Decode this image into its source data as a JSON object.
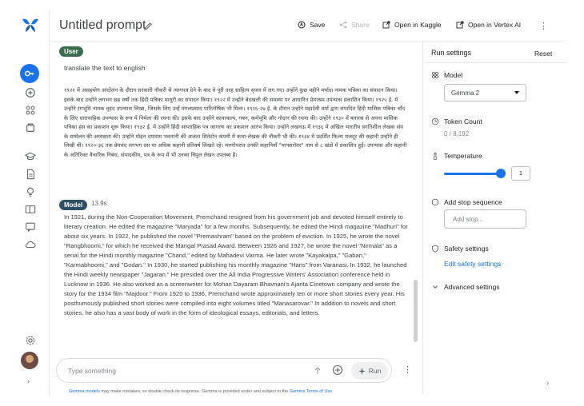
{
  "header": {
    "title": "Untitled prompt",
    "save_label": "Save",
    "share_label": "Share",
    "kaggle_label": "Open in Kaggle",
    "vertex_label": "Open in Vertex AI"
  },
  "chat": {
    "user_role": "User",
    "user_text": "translate the text to english",
    "hindi_text": "१९२१ में असहयोग आंदोलन के दौरान सरकारी नौकरी से त्यागपत्र देने के बाद वे पूरी तरह साहित्य सृजन में लग गए। उन्होंने कुछ महीने मर्यादा नामक पत्रिका का संपादन किया। इसके बाद उन्होंने लगभग छह वर्षों तक हिंदी पत्रिका माधुरी का संपादन किया। १९२२ में उन्होंने बेदखली की समस्या पर आधारित प्रेमाश्रम उपन्यास प्रकाशित किया। १९२५ ई. में उन्होंने रंगभूमि नामक वृहद उपन्यास लिखा, जिसके लिए उन्हें मंगलप्रसाद पारितोषिक भी मिला। १९२६-२७ ई. के दौरान उन्होंने महादेवी वर्मा द्वारा संपादित हिंदी मासिक पत्रिका चाँद के लिए धारावाहिक उपन्यास के रूप में निर्मला की रचना की। इसके बाद उन्होंने कायाकल्प, गबन, कर्मभूमि और गोदान की रचना की। उन्होंने १९३० में बनारस से अपना मासिक पत्रिका हंस का प्रकाशन शुरू किया। १९३२ ई. में उन्होंने हिंदी साप्ताहिक पत्र जागरण का प्रकाशन आरंभ किया। उन्होंने लखनऊ में १९३६ में अखिल भारतीय प्रगतिशील लेखक संघ के सम्मेलन की अध्यक्षता की। उन्होंने मोहन दयाराम भवनानी की अजंता सिनेटोन कंपनी में कथा-लेखक की नौकरी भी की। १९३४ में प्रदर्शित फिल्म मजदूर की कहानी उन्होंने ही लिखी थी। १९२०-३६ तक प्रेमचंद लगभग दस या अधिक कहानी प्रतिवर्ष लिखते रहे। मरणोपरांत उनकी कहानियाँ \"मानसरोवर\" नाम से ८ खंडों में प्रकाशित हुईं। उपन्यास और कहानी के अतिरिक्त वैचारिक निबंध, संपादकीय, पत्र के रूप में भी उनका विपुल लेखन उपलब्ध है।",
    "model_role": "Model",
    "model_time": "13.9s",
    "model_text": "In 1921, during the Non-Cooperation Movement, Premchand resigned from his government job and devoted himself entirely to literary creation. He edited the magazine \"Maryada\" for a few months. Subsequently, he edited the Hindi magazine \"Madhuri\" for about six years. In 1922, he published the novel \"Premashram\" based on the problem of eviction. In 1925, he wrote the novel \"Rangbhoomi,\" for which he received the Mangal Prasad Award. Between 1926 and 1927, he wrote the novel \"Nirmala\" as a serial for the Hindi monthly magazine \"Chand,\" edited by Mahadevi Varma. He later wrote \"Kayakalpa,\" \"Gaban,\" \"Karmabhoomi,\" and \"Godan.\" In 1930, he started publishing his monthly magazine \"Hans\" from Varanasi. In 1932, he launched the Hindi weekly newspaper \"Jagaran.\" He presided over the All India Progressive Writers' Association conference held in Lucknow in 1936. He also worked as a screenwriter for Mohan Dayaram Bhavnani's Ajanta Cinetown company and wrote the story for the 1934 film \"Majdoor.\" From 1920 to 1936, Premchand wrote approximately ten or more short stories every year. His posthumously published short stories were compiled into eight volumes titled \"Manasarovar.\" In addition to novels and short stories, he also has a vast body of work in the form of ideological essays, editorials, and letters."
  },
  "composer": {
    "placeholder": "Type something",
    "run_label": "Run",
    "disclaimer_link1": "Gemma models",
    "disclaimer_mid": " may make mistakes, so double check its response. Gemma is provided under and subject to the ",
    "disclaimer_link2": "Gemma Terms of Use"
  },
  "settings": {
    "title": "Run settings",
    "reset_label": "Reset",
    "model_label": "Model",
    "model_value": "Gemma 2",
    "token_label": "Token Count",
    "token_value": "0 / 8,192",
    "temperature_label": "Temperature",
    "temperature_value": "1",
    "temperature_fraction": 1.0,
    "stop_label": "Add stop sequence",
    "stop_placeholder": "Add stop...",
    "safety_label": "Safety settings",
    "safety_link": "Edit safety settings",
    "advanced_label": "Advanced settings"
  },
  "colors": {
    "accent": "#1a73e8",
    "user_badge": "#3b6e4f",
    "model_badge": "#2f4f63"
  }
}
